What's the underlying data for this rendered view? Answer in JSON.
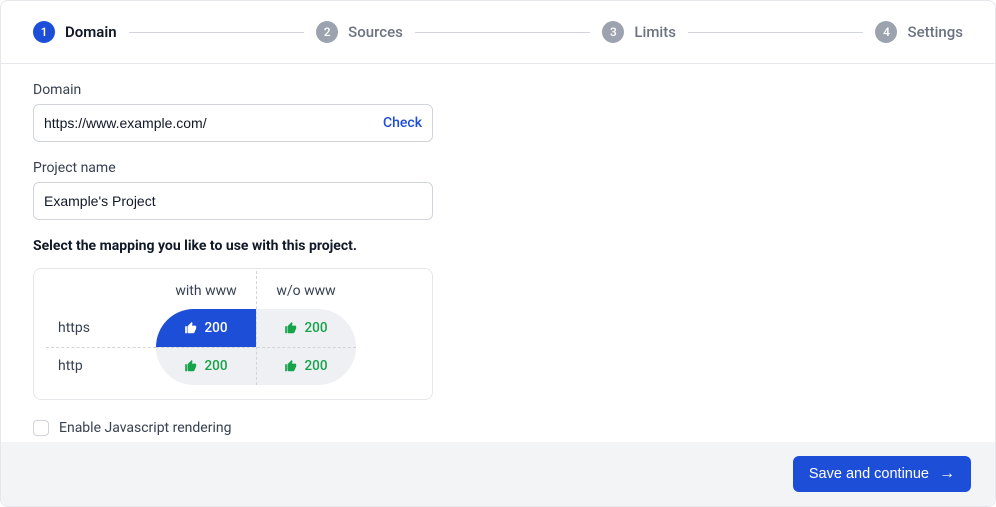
{
  "stepper": {
    "steps": [
      {
        "num": "1",
        "label": "Domain",
        "active": true
      },
      {
        "num": "2",
        "label": "Sources",
        "active": false
      },
      {
        "num": "3",
        "label": "Limits",
        "active": false
      },
      {
        "num": "4",
        "label": "Settings",
        "active": false
      }
    ]
  },
  "form": {
    "domain_label": "Domain",
    "domain_value": "https://www.example.com/",
    "check_label": "Check",
    "project_label": "Project name",
    "project_value": "Example's Project"
  },
  "mapping": {
    "title": "Select the mapping you like to use with this project.",
    "col1": "with www",
    "col2": "w/o www",
    "row1": "https",
    "row2": "http",
    "values": {
      "https_www": "200",
      "https_nowww": "200",
      "http_www": "200",
      "http_nowww": "200"
    }
  },
  "js_render": {
    "label": "Enable Javascript rendering",
    "checked": false
  },
  "footer": {
    "save_label": "Save and continue"
  }
}
